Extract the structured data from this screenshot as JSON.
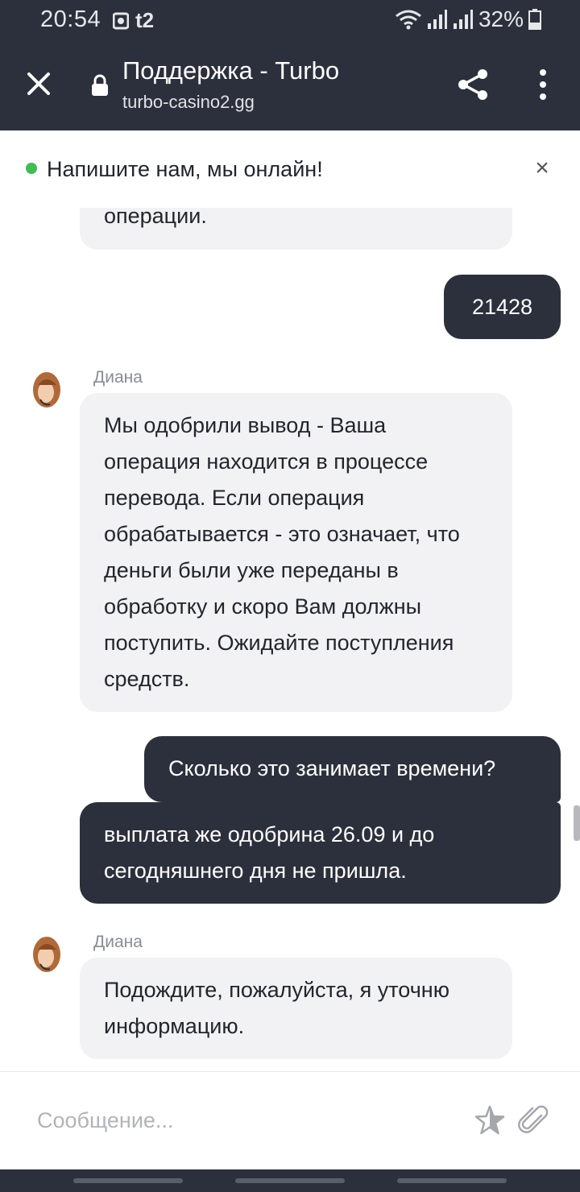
{
  "status_bar": {
    "time": "20:54",
    "carrier": "t2",
    "battery": "32%"
  },
  "browser": {
    "title": "Поддержка - Turbo",
    "url": "turbo-casino2.gg"
  },
  "banner": {
    "text": "Напишите нам, мы онлайн!",
    "close": "×",
    "status_color": "#3fbd54"
  },
  "messages": [
    {
      "from": "agent",
      "text": "операции."
    },
    {
      "from": "user",
      "text": "21428"
    },
    {
      "from": "agent",
      "name": "Диана",
      "text": "Мы одобрили вывод - Ваша операция находится в процессе перевода. Если операция обрабатывается - это означает, что деньги были уже переданы в обработку и скоро Вам должны поступить. Ожидайте поступления средств."
    },
    {
      "from": "user",
      "text": "Сколько это занимает времени?"
    },
    {
      "from": "user",
      "text": "выплата же одобрина 26.09 и до сегодняшнего дня не пришла."
    },
    {
      "from": "agent",
      "name": "Диана",
      "text": "Подождите, пожалуйста, я уточню информацию."
    }
  ],
  "composer": {
    "placeholder": "Сообщение..."
  },
  "colors": {
    "header_bg": "#2c303c",
    "user_bubble": "#2c303c",
    "agent_bubble": "#f2f2f4"
  }
}
